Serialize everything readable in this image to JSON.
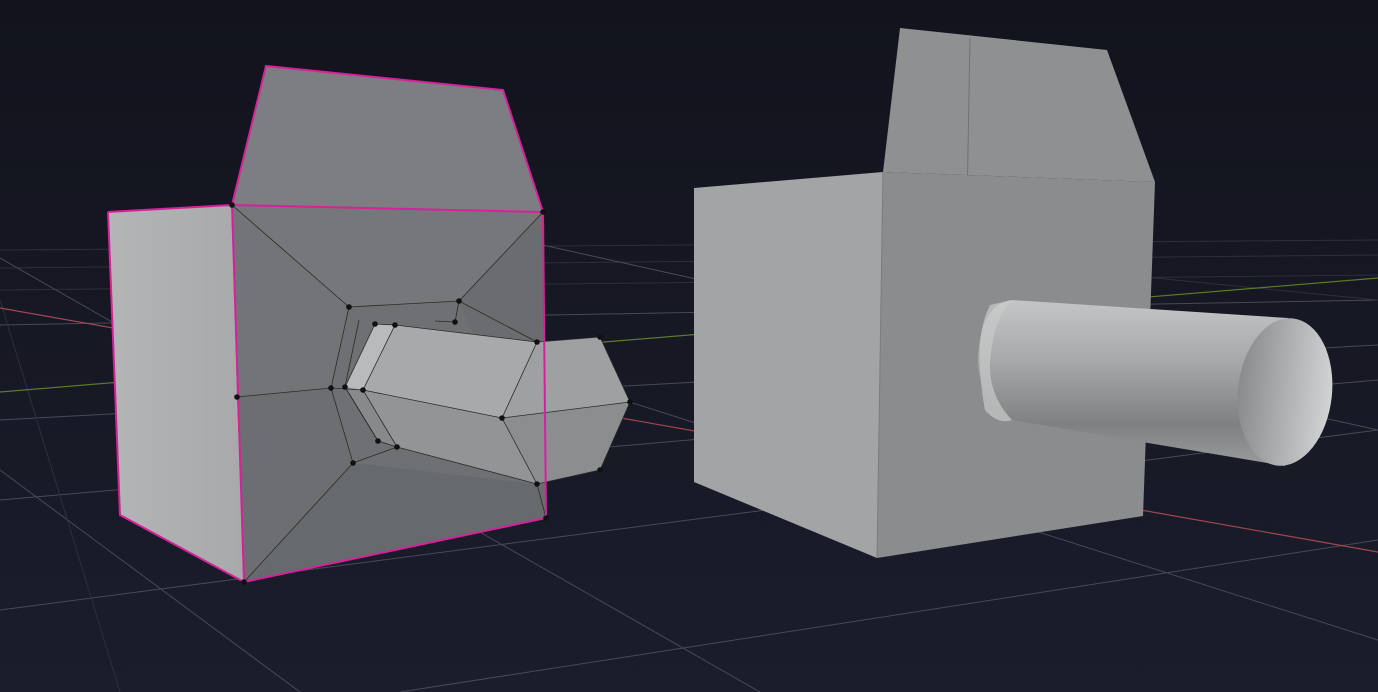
{
  "viewport": {
    "background": "#161826",
    "grid_color": "#474a56",
    "x_axis_color": "#a0484f",
    "y_axis_color": "#5b7a2e"
  },
  "objects": [
    {
      "name": "edit-mode-model",
      "mode": "edit",
      "selection_outline_color": "#d7219a",
      "vertex_color": "#111111"
    },
    {
      "name": "shaded-model",
      "mode": "object",
      "surface_color": "#9a9c9e"
    }
  ]
}
